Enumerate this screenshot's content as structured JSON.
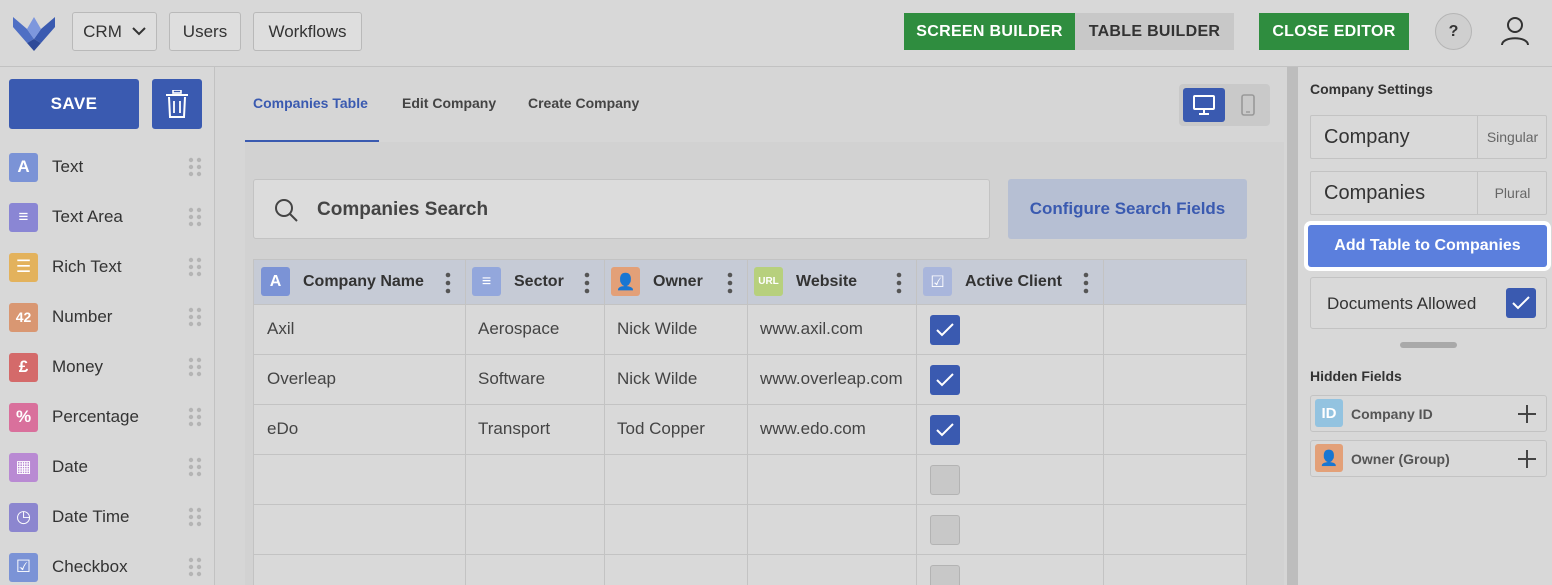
{
  "topbar": {
    "crm_label": "CRM",
    "users_label": "Users",
    "workflows_label": "Workflows",
    "screen_builder_label": "SCREEN BUILDER",
    "table_builder_label": "TABLE BUILDER",
    "close_editor_label": "CLOSE EDITOR",
    "help_label": "?"
  },
  "sidebar": {
    "save_label": "SAVE",
    "fields": [
      {
        "label": "Text",
        "icon": "A",
        "color": "#7b93d6"
      },
      {
        "label": "Text Area",
        "icon": "≡",
        "color": "#8a86d4"
      },
      {
        "label": "Rich Text",
        "icon": "☰",
        "color": "#e3b25c"
      },
      {
        "label": "Number",
        "icon": "42",
        "color": "#d99772"
      },
      {
        "label": "Money",
        "icon": "£",
        "color": "#d46a6a"
      },
      {
        "label": "Percentage",
        "icon": "%",
        "color": "#d9709c"
      },
      {
        "label": "Date",
        "icon": "▦",
        "color": "#b98ad3"
      },
      {
        "label": "Date Time",
        "icon": "◷",
        "color": "#8c86cf"
      },
      {
        "label": "Checkbox",
        "icon": "☑",
        "color": "#7b93d6"
      }
    ]
  },
  "tabs": [
    {
      "label": "Companies Table",
      "active": true
    },
    {
      "label": "Edit Company",
      "active": false
    },
    {
      "label": "Create Company",
      "active": false
    }
  ],
  "search": {
    "placeholder": "Companies Search",
    "configure_label": "Configure Search Fields"
  },
  "table": {
    "columns": [
      {
        "label": "Company Name",
        "icon": "A",
        "color": "#7b93d6"
      },
      {
        "label": "Sector",
        "icon": "≡",
        "color": "#93a7dc"
      },
      {
        "label": "Owner",
        "icon": "👤",
        "color": "#e3a078"
      },
      {
        "label": "Website",
        "icon": "URL",
        "color": "#b7d07d"
      },
      {
        "label": "Active Client",
        "icon": "☑",
        "color": "#a9b6dc"
      }
    ],
    "rows": [
      {
        "company": "Axil",
        "sector": "Aerospace",
        "owner": "Nick Wilde",
        "website": "www.axil.com",
        "active": true
      },
      {
        "company": "Overleap",
        "sector": "Software",
        "owner": "Nick Wilde",
        "website": "www.overleap.com",
        "active": true
      },
      {
        "company": "eDo",
        "sector": "Transport",
        "owner": "Tod Copper",
        "website": "www.edo.com",
        "active": true
      },
      {
        "company": "",
        "sector": "",
        "owner": "",
        "website": "",
        "active": false
      },
      {
        "company": "",
        "sector": "",
        "owner": "",
        "website": "",
        "active": false
      },
      {
        "company": "",
        "sector": "",
        "owner": "",
        "website": "",
        "active": false
      }
    ]
  },
  "settings": {
    "title": "Company  Settings",
    "singular_value": "Company",
    "singular_suffix": "Singular",
    "plural_value": "Companies",
    "plural_suffix": "Plural",
    "add_table_label": "Add Table to Companies",
    "documents_label": "Documents Allowed",
    "documents_allowed": true,
    "hidden_title": "Hidden Fields",
    "hidden_fields": [
      {
        "label": "Company ID",
        "icon": "ID",
        "color": "#93c3e0"
      },
      {
        "label": "Owner (Group)",
        "icon": "👤",
        "color": "#e3a078"
      }
    ]
  },
  "colors": {
    "primary": "#3a5ab0",
    "green": "#2f8d3f",
    "highlight_button": "#5b7fdd"
  }
}
